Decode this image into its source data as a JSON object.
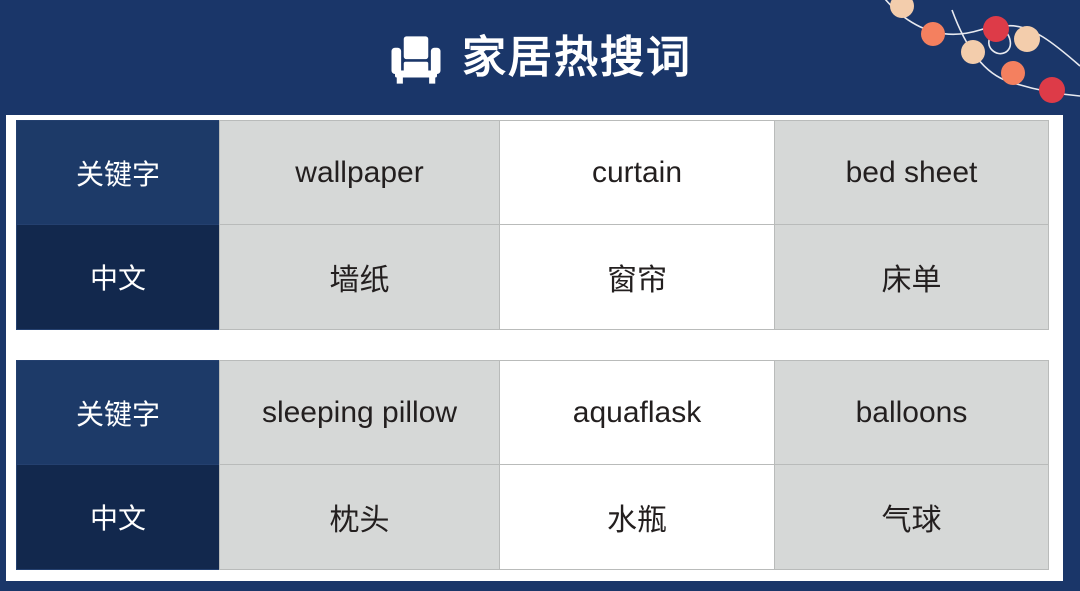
{
  "header": {
    "title": "家居热搜词",
    "icon": "armchair-icon",
    "background_color": "#1a3669",
    "title_color": "#ffffff",
    "decoration": {
      "name": "string-lights-decoration",
      "bulb_colors": [
        "#f3cdac",
        "#f4805f",
        "#dd3b48"
      ]
    }
  },
  "colors": {
    "navy": "#1a3669",
    "navy_key_row": "#1d3a68",
    "navy_cn_row": "#12284d",
    "cell_gray": "#d6d8d7",
    "cell_white": "#ffffff",
    "grid_line": "#b9bbba",
    "text": "#231f1f"
  },
  "table": {
    "row_labels": {
      "keyword": "关键字",
      "chinese": "中文"
    },
    "blocks": [
      {
        "keywords": [
          "wallpaper",
          "curtain",
          "bed sheet"
        ],
        "chinese": [
          "墙纸",
          "窗帘",
          "床单"
        ],
        "fills": [
          "gray",
          "white",
          "gray"
        ]
      },
      {
        "keywords": [
          "sleeping pillow",
          "aquaflask",
          "balloons"
        ],
        "chinese": [
          "枕头",
          "水瓶",
          "气球"
        ],
        "fills": [
          "gray",
          "white",
          "gray"
        ]
      }
    ]
  }
}
